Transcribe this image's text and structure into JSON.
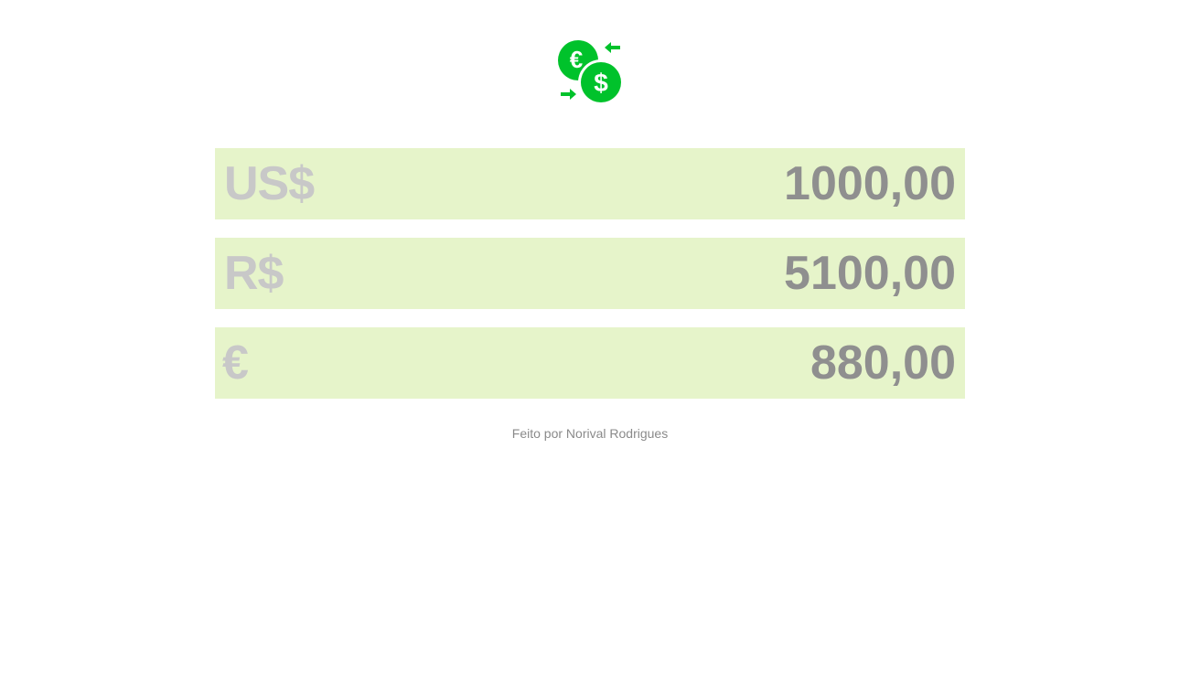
{
  "logo": {
    "icon": "currency-exchange-icon",
    "coin_back_symbol": "€",
    "coin_front_symbol": "$",
    "color": "#00c22b"
  },
  "rows": [
    {
      "currency": "US$",
      "value": "1000,00"
    },
    {
      "currency": "R$",
      "value": "5100,00"
    },
    {
      "currency": "€",
      "value": "880,00"
    }
  ],
  "footer": {
    "text": "Feito por Norival Rodrigues"
  },
  "colors": {
    "row_background": "#e6f4ca",
    "currency_text": "#c8c8c8",
    "amount_text": "#8f8f8f",
    "accent": "#00c22b"
  }
}
